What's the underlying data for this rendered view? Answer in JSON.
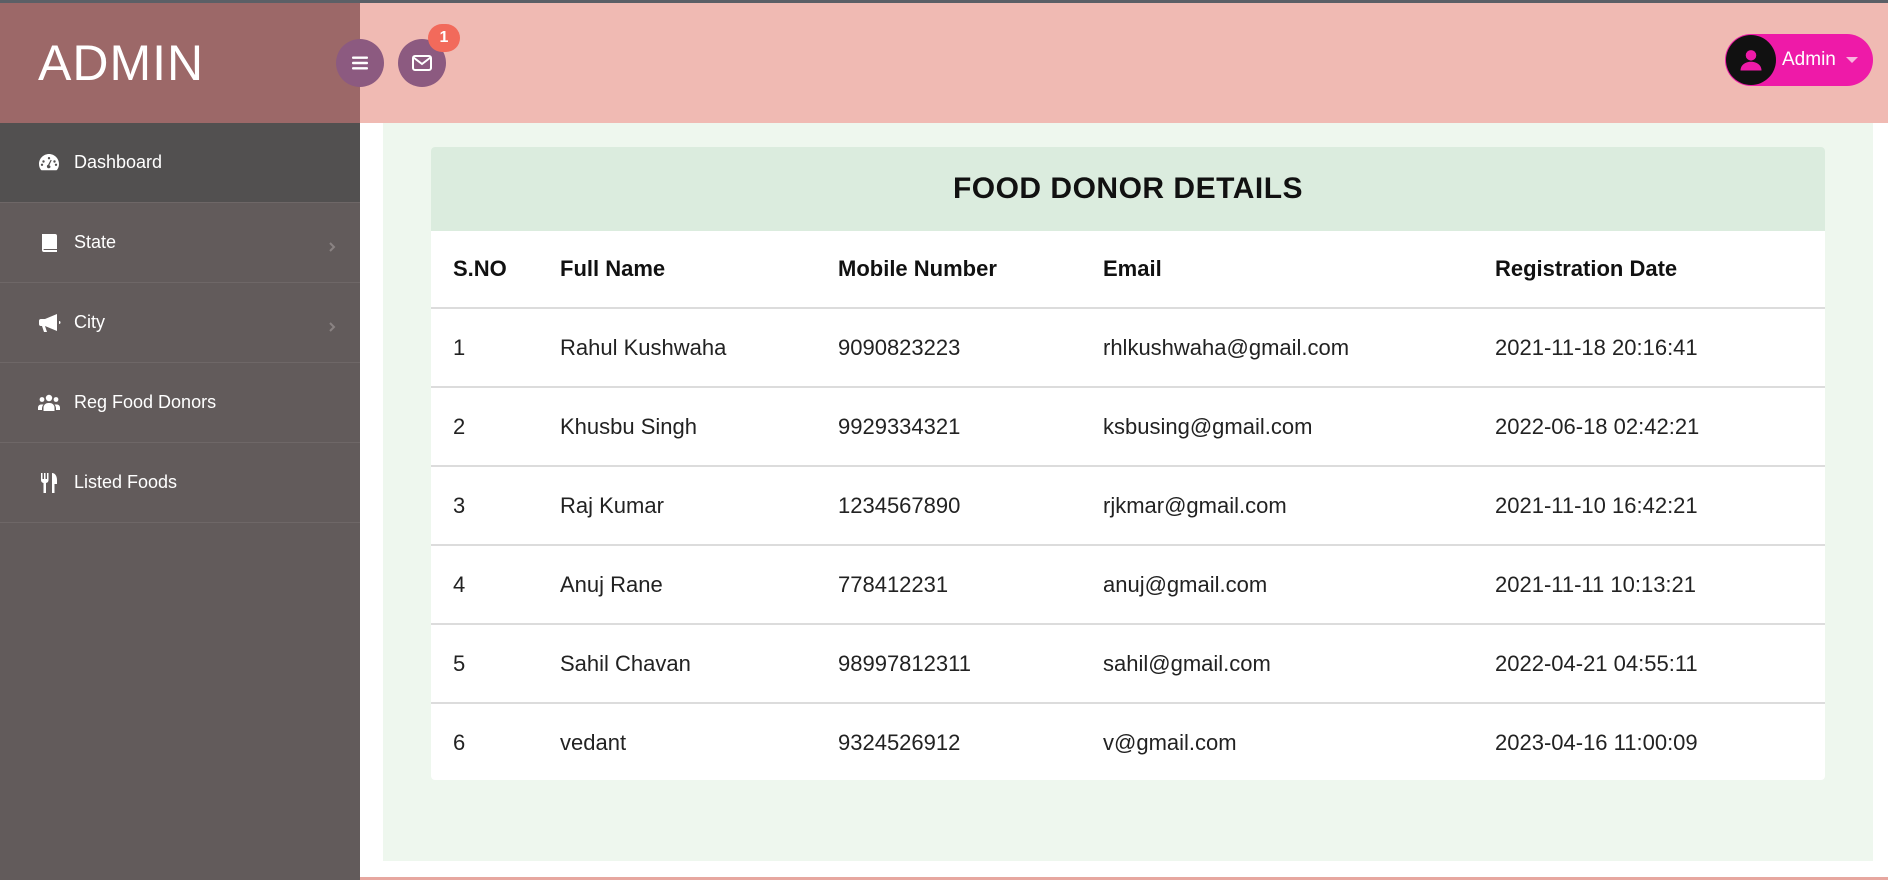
{
  "brand": {
    "title": "ADMIN"
  },
  "sidebar": {
    "items": [
      {
        "label": "Dashboard",
        "icon": "dashboard-icon",
        "has_chevron": false
      },
      {
        "label": "State",
        "icon": "book-icon",
        "has_chevron": true
      },
      {
        "label": "City",
        "icon": "bullhorn-icon",
        "has_chevron": true
      },
      {
        "label": "Reg Food Donors",
        "icon": "users-icon",
        "has_chevron": false
      },
      {
        "label": "Listed Foods",
        "icon": "utensils-icon",
        "has_chevron": false
      }
    ]
  },
  "header": {
    "notification_count": "1",
    "user_name": "Admin"
  },
  "table": {
    "title": "FOOD DONOR DETAILS",
    "columns": [
      "S.NO",
      "Full Name",
      "Mobile Number",
      "Email",
      "Registration Date"
    ],
    "rows": [
      [
        "1",
        "Rahul Kushwaha",
        "9090823223",
        "rhlkushwaha@gmail.com",
        "2021-11-18 20:16:41"
      ],
      [
        "2",
        "Khusbu Singh",
        "9929334321",
        "ksbusing@gmail.com",
        "2022-06-18 02:42:21"
      ],
      [
        "3",
        "Raj Kumar",
        "1234567890",
        "rjkmar@gmail.com",
        "2021-11-10 16:42:21"
      ],
      [
        "4",
        "Anuj Rane",
        "778412231",
        "anuj@gmail.com",
        "2021-11-11 10:13:21"
      ],
      [
        "5",
        "Sahil Chavan",
        "98997812311",
        "sahil@gmail.com",
        "2022-04-21 04:55:11"
      ],
      [
        "6",
        "vedant",
        "9324526912",
        "v@gmail.com",
        "2023-04-16 11:00:09"
      ]
    ]
  },
  "colors": {
    "sidebar": "#625b5b",
    "brand": "#9c6868",
    "header": "#f0bab3",
    "accent_pink": "#ee1aa8",
    "badge": "#f26a5b",
    "card_header": "#dbecde"
  }
}
